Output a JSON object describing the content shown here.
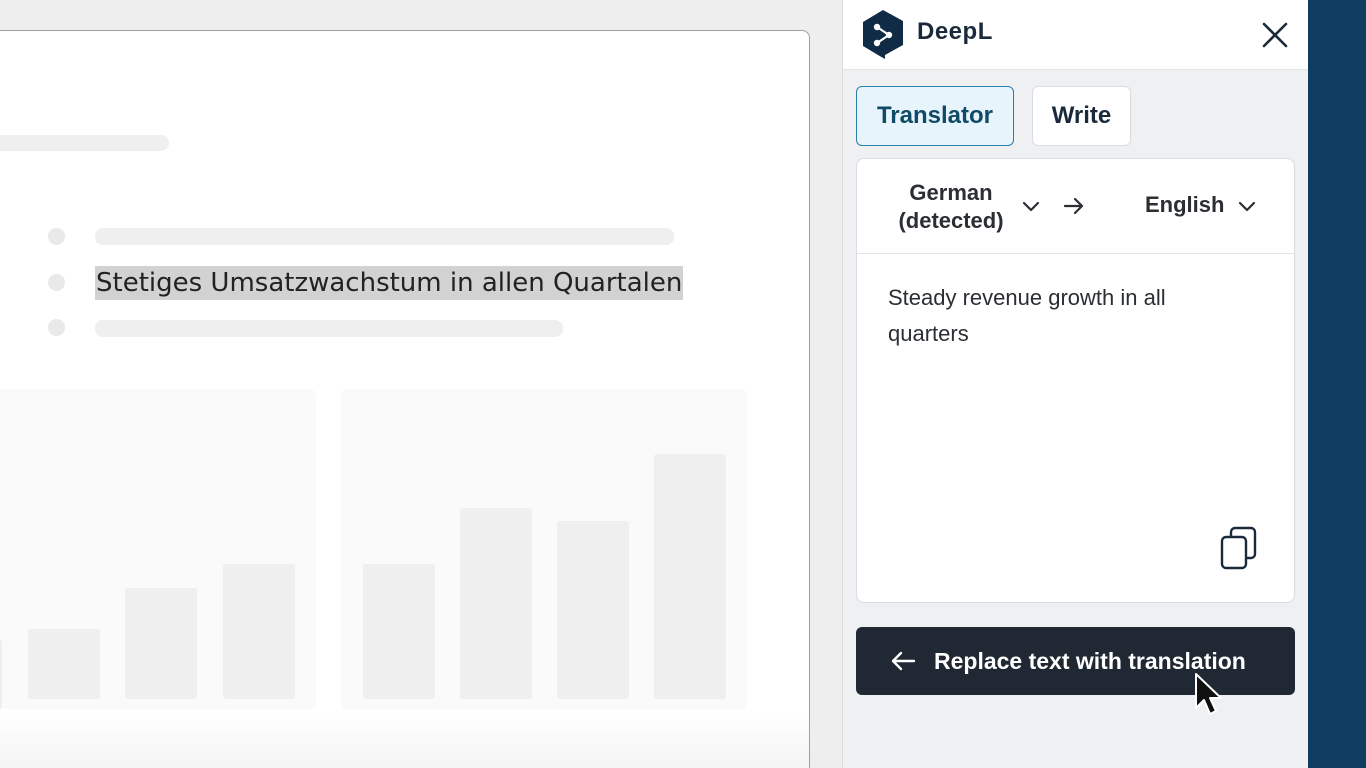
{
  "document": {
    "highlighted_text": "Stetiges Umsatzwachstum in allen Quartalen"
  },
  "sidebar": {
    "brand": "DeepL",
    "tabs": [
      {
        "label": "Translator",
        "active": true
      },
      {
        "label": "Write",
        "active": false
      }
    ],
    "source_language": "German (detected)",
    "target_language": "English",
    "translation": "Steady revenue growth in all quarters",
    "replace_button_label": "Replace text with translation"
  },
  "colors": {
    "accent": "#0f3d5f",
    "active_tab_bg": "#e8f4fb",
    "button_bg": "#202833"
  },
  "icons": [
    "deepl-logo-icon",
    "close-icon",
    "chevron-down-icon",
    "arrow-right-icon",
    "copy-icon",
    "arrow-left-icon",
    "mouse-cursor-icon"
  ]
}
